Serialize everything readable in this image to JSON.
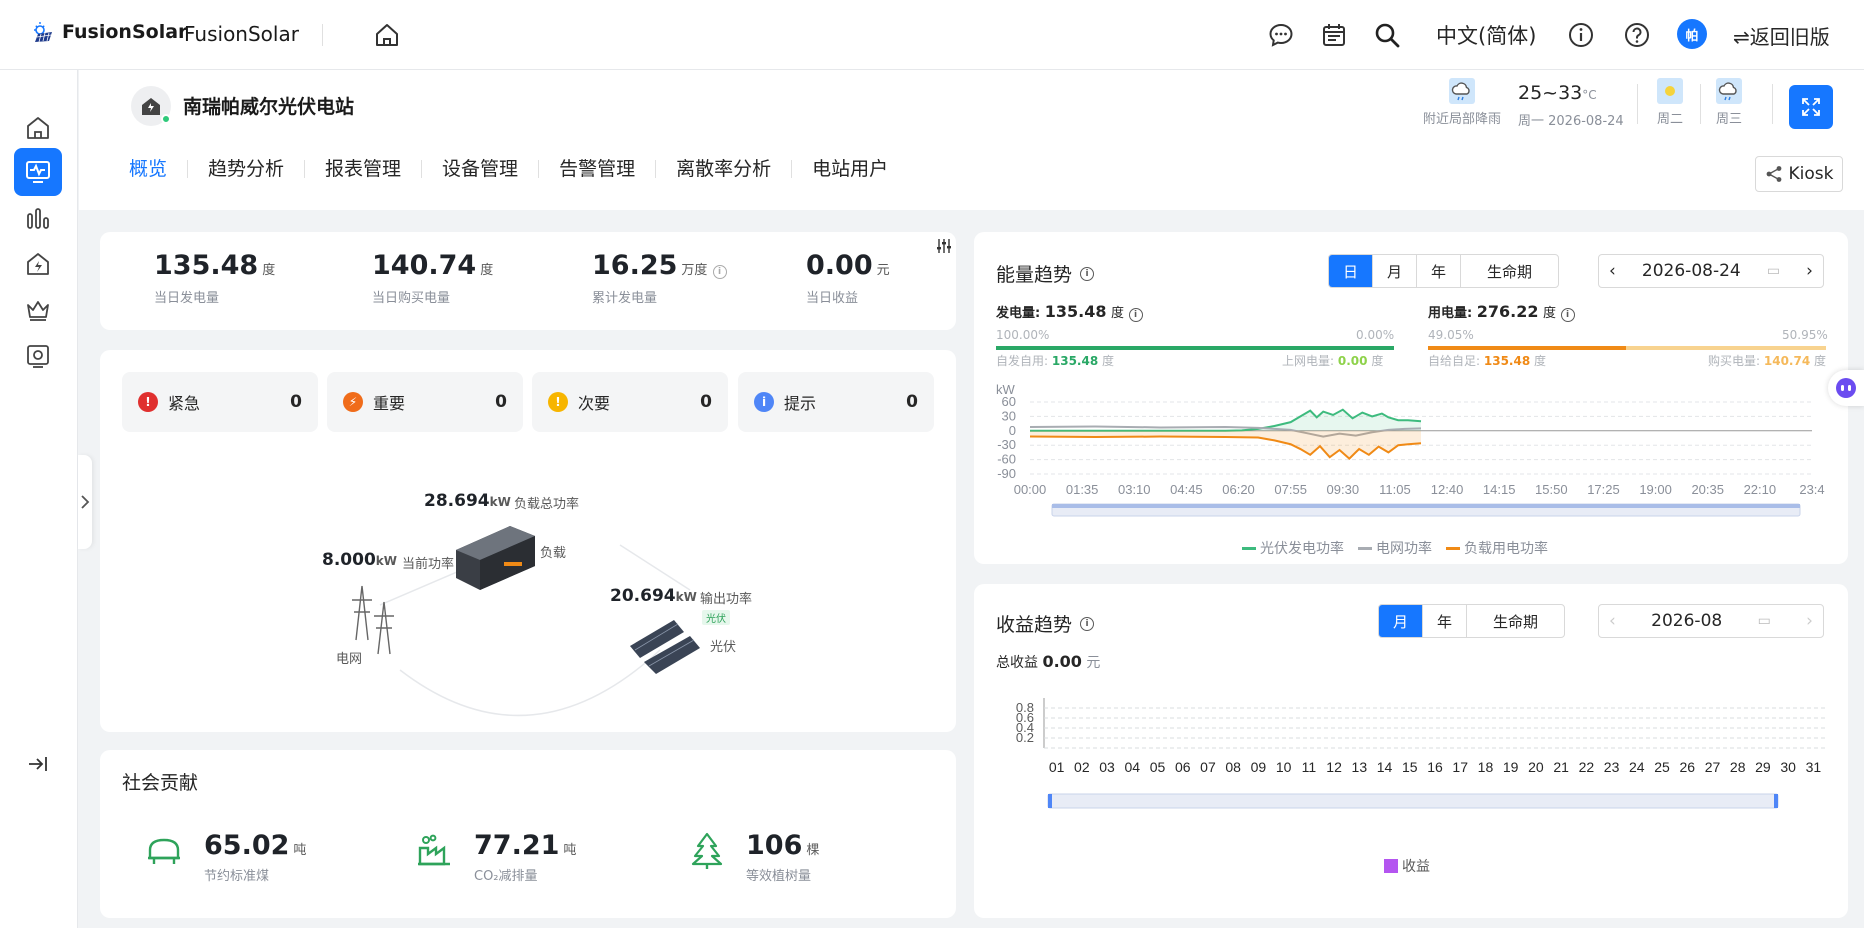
{
  "topbar": {
    "logo_text": "FusionSolar",
    "app_name": "FusionSolar",
    "language": "中文(简体)",
    "avatar_initial": "帕",
    "back_old": "⇌返回旧版"
  },
  "header": {
    "plant_name": "南瑞帕威尔光伏电站",
    "tabs": [
      "概览",
      "趋势分析",
      "报表管理",
      "设备管理",
      "告警管理",
      "离散率分析",
      "电站用户"
    ],
    "active_tab": "概览",
    "weather": {
      "today_desc": "附近局部降雨",
      "temp": "25~33",
      "temp_unit": "°C",
      "date": "周一  2026-08-24",
      "day2": "周二",
      "day3": "周三"
    },
    "kiosk_label": "Kiosk"
  },
  "kpi": [
    {
      "value": "135.48",
      "unit": "度",
      "label": "当日发电量"
    },
    {
      "value": "140.74",
      "unit": "度",
      "label": "当日购买电量"
    },
    {
      "value": "16.25",
      "unit": "万度",
      "label": "累计发电量"
    },
    {
      "value": "0.00",
      "unit": "元",
      "label": "当日收益"
    }
  ],
  "alarms": [
    {
      "label": "紧急",
      "count": "0",
      "color": "#e0302f"
    },
    {
      "label": "重要",
      "count": "0",
      "color": "#f06c1a"
    },
    {
      "label": "次要",
      "count": "0",
      "color": "#f7b500"
    },
    {
      "label": "提示",
      "count": "0",
      "color": "#4f86f7"
    }
  ],
  "flow": {
    "load_value": "28.694",
    "load_unit": "kW",
    "load_label": "负载总功率",
    "load_name": "负载",
    "grid_value": "8.000",
    "grid_unit": "kW",
    "grid_label": "当前功率",
    "grid_name": "电网",
    "pv_value": "20.694",
    "pv_unit": "kW",
    "pv_label": "输出功率",
    "pv_tag": "光伏",
    "pv_name": "光伏"
  },
  "social": {
    "title": "社会贡献",
    "items": [
      {
        "value": "65.02",
        "unit": "吨",
        "label": "节约标准煤"
      },
      {
        "value": "77.21",
        "unit": "吨",
        "label": "CO₂减排量"
      },
      {
        "value": "106",
        "unit": "棵",
        "label": "等效植树量"
      }
    ]
  },
  "energy": {
    "title": "能量趋势",
    "periods": [
      "日",
      "月",
      "年",
      "生命期"
    ],
    "active_period": "日",
    "date": "2026-08-24",
    "gen_label": "发电量:",
    "gen_value": "135.48",
    "gen_unit": "度",
    "gen_left_pct": "100.00%",
    "gen_right_pct": "0.00%",
    "self_use_label": "自发自用:",
    "self_use_value": "135.48",
    "self_use_unit": "度",
    "export_label": "上网电量:",
    "export_value": "0.00",
    "export_unit": "度",
    "use_label": "用电量:",
    "use_value": "276.22",
    "use_unit": "度",
    "use_left_pct": "49.05%",
    "use_right_pct": "50.95%",
    "self_supply_label": "自给自足:",
    "self_supply_value": "135.48",
    "self_supply_unit": "度",
    "buy_label": "购买电量:",
    "buy_value": "140.74",
    "buy_unit": "度",
    "legend": [
      "光伏发电功率",
      "电网功率",
      "负载用电功率"
    ],
    "legend_colors": [
      "#3dbb7e",
      "#a8acb2",
      "#f08a16"
    ]
  },
  "revenue": {
    "title": "收益趋势",
    "periods": [
      "月",
      "年",
      "生命期"
    ],
    "active_period": "月",
    "date": "2026-08",
    "total_label": "总收益",
    "total_value": "0.00",
    "total_unit": "元",
    "legend": "收益",
    "legend_color": "#b455f0"
  },
  "chart_data": [
    {
      "type": "line",
      "title": "能量趋势",
      "ylabel": "kW",
      "ylim": [
        -90,
        60
      ],
      "yticks": [
        60,
        30,
        0,
        -30,
        -60,
        -90
      ],
      "x_ticks": [
        "00:00",
        "01:35",
        "03:10",
        "04:45",
        "06:20",
        "07:55",
        "09:30",
        "11:05",
        "12:40",
        "14:15",
        "15:50",
        "17:25",
        "19:00",
        "20:35",
        "22:10",
        "23:4"
      ],
      "x_range_hours": [
        0,
        24
      ],
      "series": [
        {
          "name": "光伏发电功率",
          "color": "#3dbb7e",
          "points": [
            [
              0,
              0
            ],
            [
              6.0,
              0
            ],
            [
              6.5,
              1
            ],
            [
              7.0,
              4
            ],
            [
              7.5,
              10
            ],
            [
              8.0,
              18
            ],
            [
              8.3,
              30
            ],
            [
              8.6,
              42
            ],
            [
              8.8,
              28
            ],
            [
              9.0,
              40
            ],
            [
              9.3,
              33
            ],
            [
              9.6,
              44
            ],
            [
              9.9,
              26
            ],
            [
              10.2,
              38
            ],
            [
              10.5,
              30
            ],
            [
              10.8,
              36
            ],
            [
              11.0,
              28
            ],
            [
              11.3,
              22
            ],
            [
              11.6,
              22
            ],
            [
              12.0,
              20
            ]
          ]
        },
        {
          "name": "电网功率",
          "color": "#a8acb2",
          "points": [
            [
              0,
              8
            ],
            [
              2,
              9
            ],
            [
              4,
              7
            ],
            [
              6.0,
              8
            ],
            [
              7.0,
              6
            ],
            [
              7.5,
              4
            ],
            [
              8.0,
              2
            ],
            [
              8.5,
              -5
            ],
            [
              9.0,
              -12
            ],
            [
              9.5,
              -6
            ],
            [
              10.0,
              -10
            ],
            [
              10.5,
              -3
            ],
            [
              11.0,
              2
            ],
            [
              11.5,
              4
            ],
            [
              12.0,
              5
            ]
          ]
        },
        {
          "name": "负载用电功率",
          "color": "#f08a16",
          "points": [
            [
              0,
              -12
            ],
            [
              2,
              -13
            ],
            [
              4,
              -12
            ],
            [
              6.0,
              -13
            ],
            [
              7.0,
              -14
            ],
            [
              7.5,
              -20
            ],
            [
              8.0,
              -28
            ],
            [
              8.3,
              -38
            ],
            [
              8.6,
              -50
            ],
            [
              8.9,
              -32
            ],
            [
              9.2,
              -55
            ],
            [
              9.5,
              -40
            ],
            [
              9.8,
              -58
            ],
            [
              10.1,
              -38
            ],
            [
              10.4,
              -50
            ],
            [
              10.7,
              -33
            ],
            [
              11.0,
              -45
            ],
            [
              11.3,
              -30
            ],
            [
              11.6,
              -28
            ],
            [
              12.0,
              -26
            ]
          ]
        }
      ]
    },
    {
      "type": "bar",
      "title": "收益趋势",
      "categories": [
        "01",
        "02",
        "03",
        "04",
        "05",
        "06",
        "07",
        "08",
        "09",
        "10",
        "11",
        "12",
        "13",
        "14",
        "15",
        "16",
        "17",
        "18",
        "19",
        "20",
        "21",
        "22",
        "23",
        "24",
        "25",
        "26",
        "27",
        "28",
        "29",
        "30",
        "31"
      ],
      "series": [
        {
          "name": "收益",
          "values": [
            0,
            0,
            0,
            0,
            0,
            0,
            0,
            0,
            0,
            0,
            0,
            0,
            0,
            0,
            0,
            0,
            0,
            0,
            0,
            0,
            0,
            0,
            0,
            0,
            0,
            0,
            0,
            0,
            0,
            0,
            0
          ]
        }
      ],
      "ylim": [
        0,
        1
      ],
      "yticks": [
        "0.2",
        "0.4",
        "0.6",
        "0.8"
      ]
    }
  ]
}
